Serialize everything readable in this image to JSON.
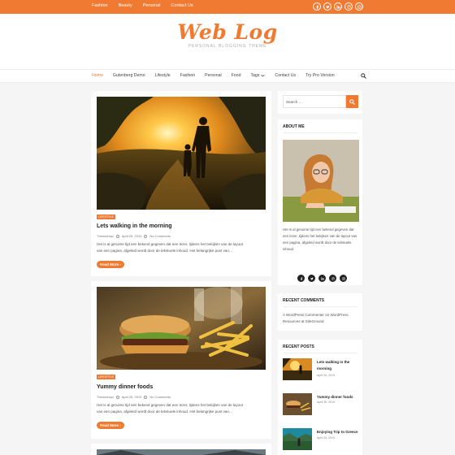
{
  "topbar": {
    "links": [
      "Fashion",
      "Beauty",
      "Personal",
      "Contact Us"
    ],
    "social_icons": [
      "facebook-icon",
      "twitter-icon",
      "linkedin-icon",
      "dribbble-icon",
      "instagram-icon"
    ]
  },
  "header": {
    "site_title": "Web Log",
    "tagline": "Personal Blogging Theme"
  },
  "nav": {
    "items": [
      {
        "label": "Home",
        "active": true
      },
      {
        "label": "Gutenberg Demo"
      },
      {
        "label": "Lifestyle"
      },
      {
        "label": "Fashion"
      },
      {
        "label": "Personal"
      },
      {
        "label": "Food"
      },
      {
        "label": "Tags"
      },
      {
        "label": "Contact Us"
      },
      {
        "label": "Try Pro Version"
      }
    ]
  },
  "posts": [
    {
      "category": "Lifestyle",
      "title": "Lets walking in the morning",
      "author": "Themeinwp",
      "date": "April 25, 2019",
      "comments": "No Comments",
      "excerpt_lines": [
        "Het is al geruime tijd een bekend gegeven dat een lezer, tijdens het bekijken van de layout",
        "van een pagina, afgeleid wordt door de tekstuele inhoud. Het belangrijke punt van…"
      ],
      "read_more": "Read More ›"
    },
    {
      "category": "Lifestyle",
      "title": "Yummy dinner foods",
      "author": "Themeinwp",
      "date": "April 25, 2019",
      "comments": "No Comments",
      "excerpt_lines": [
        "Het is al geruime tijd een bekend gegeven dat een lezer, tijdens het bekijken van de layout",
        "van een pagina, afgeleid wordt door de tekstuele inhoud. Het belangrijke punt van…"
      ],
      "read_more": "Read More ›"
    }
  ],
  "sidebar": {
    "search_label": "Search …",
    "about": {
      "title": "About Me",
      "text": "Het is al geruime tijd een bekend gegeven dat een lezer, tijdens het bekijken van de layout van een pagina, afgeleid wordt door de tekstuele inhoud."
    },
    "recent_comments": {
      "title": "Recent Comments",
      "text": "A WordPress Commenter on WordPress Resources at SiteGround"
    },
    "recent_posts": {
      "title": "Recent Posts",
      "items": [
        {
          "title": "Lets walking in the morning",
          "date": "April 25, 2019"
        },
        {
          "title": "Yummy dinner foods",
          "date": "April 25, 2019"
        },
        {
          "title": "Enjoying Trip to Greece",
          "date": "April 25, 2019"
        }
      ]
    }
  }
}
